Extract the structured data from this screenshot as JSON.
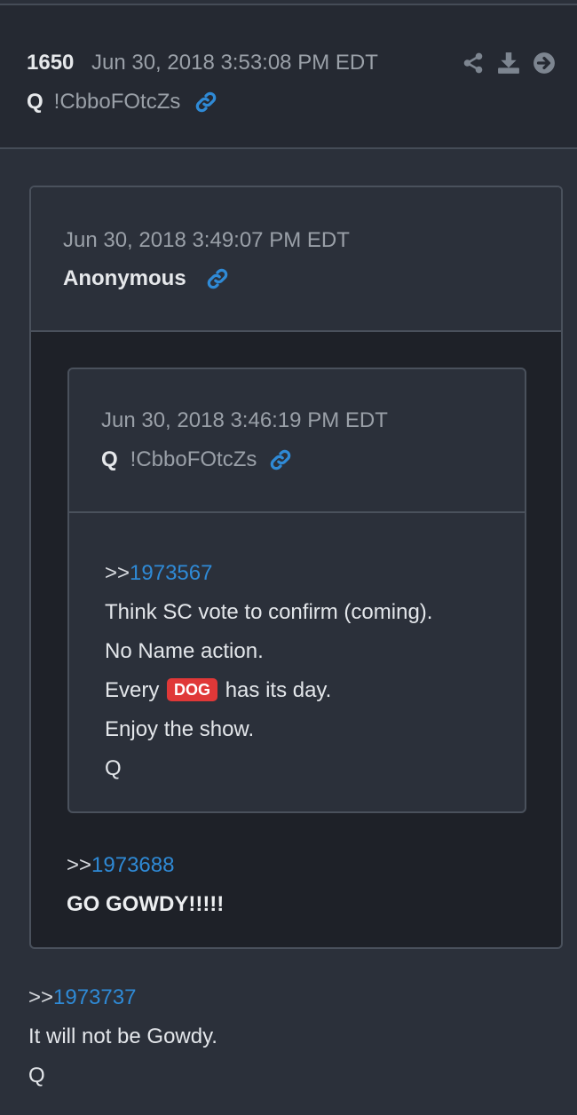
{
  "post": {
    "number": "1650",
    "date": "Jun 30, 2018 3:53:08 PM EDT",
    "author": "Q",
    "tripcode": "!CbboFOtcZs",
    "actions": [
      "share-icon",
      "download-icon",
      "arrow-right-circle-icon"
    ]
  },
  "quote_outer": {
    "date": "Jun 30, 2018 3:49:07 PM EDT",
    "author": "Anonymous",
    "reply_prefix": ">>",
    "reply_ref": "1973688",
    "text": "GO GOWDY!!!!!"
  },
  "quote_inner": {
    "date": "Jun 30, 2018 3:46:19 PM EDT",
    "author": "Q",
    "tripcode": "!CbboFOtcZs",
    "reply_prefix": ">>",
    "reply_ref": "1973567",
    "line1": "Think SC vote to confirm (coming).",
    "line2": "No Name action.",
    "line3_pre": "Every ",
    "line3_badge": "DOG",
    "line3_post": " has its day.",
    "line4": "Enjoy the show.",
    "line5": "Q"
  },
  "main": {
    "reply_prefix": ">>",
    "reply_ref": "1973737",
    "line1": "It will not be Gowdy.",
    "line2": "Q"
  },
  "colors": {
    "background": "#2b303a",
    "header_bg": "#252932",
    "link": "#2f8ad6",
    "badge": "#e03838"
  }
}
